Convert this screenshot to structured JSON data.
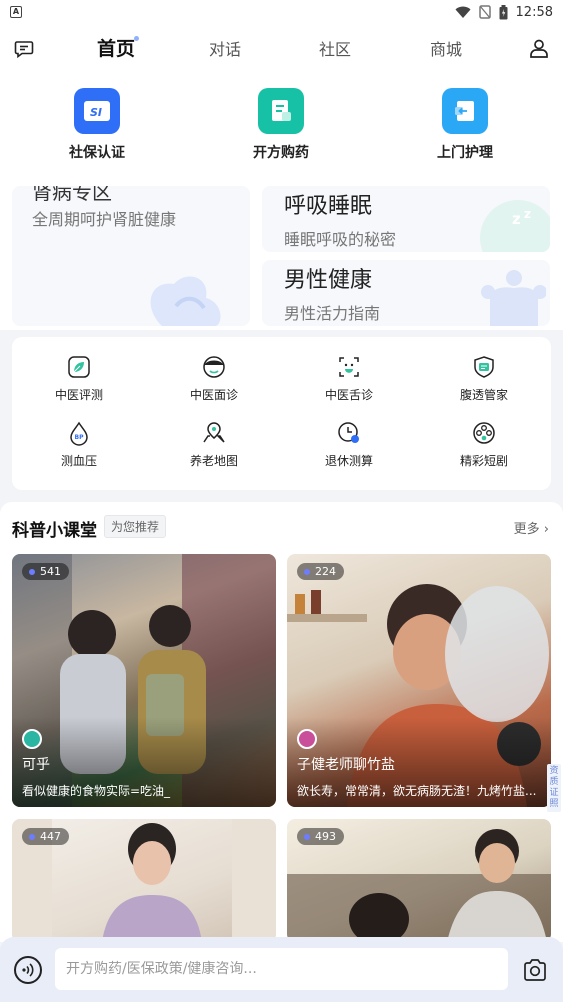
{
  "status_bar": {
    "time": "12:58"
  },
  "header": {
    "tabs": [
      "首页",
      "对话",
      "社区",
      "商城"
    ],
    "active_tab": 0
  },
  "quick_services": [
    {
      "label": "社保认证",
      "icon": "social-security-icon",
      "color": "#2f6ef6"
    },
    {
      "label": "开方购药",
      "icon": "prescription-icon",
      "color": "#16c1a6"
    },
    {
      "label": "上门护理",
      "icon": "home-care-icon",
      "color": "#2aa7f5"
    }
  ],
  "feature_cards": {
    "big": {
      "title": "肾病专区",
      "subtitle": "全周期呵护肾脏健康"
    },
    "small": [
      {
        "title": "呼吸睡眠",
        "subtitle": "睡眠呼吸的秘密"
      },
      {
        "title": "男性健康",
        "subtitle": "男性活力指南"
      }
    ]
  },
  "tcm_grid": [
    {
      "label": "中医评测",
      "icon": "leaf-icon"
    },
    {
      "label": "中医面诊",
      "icon": "face-icon"
    },
    {
      "label": "中医舌诊",
      "icon": "tongue-icon"
    },
    {
      "label": "腹透管家",
      "icon": "dialysis-icon"
    },
    {
      "label": "测血压",
      "icon": "blood-pressure-icon"
    },
    {
      "label": "养老地图",
      "icon": "map-pin-icon"
    },
    {
      "label": "退休测算",
      "icon": "clock-icon"
    },
    {
      "label": "精彩短剧",
      "icon": "film-reel-icon"
    }
  ],
  "science": {
    "title": "科普小课堂",
    "tag": "为您推荐",
    "more": "更多",
    "videos": [
      {
        "views": "541",
        "author": "可乎",
        "caption": "看似健康的食物实际=吃油_"
      },
      {
        "views": "224",
        "author": "子健老师聊竹盐",
        "caption": "欲长寿，常常清，欲无病肠无渣！九烤竹盐..."
      },
      {
        "views": "447",
        "author": "",
        "caption": ""
      },
      {
        "views": "493",
        "author": "",
        "caption": ""
      }
    ]
  },
  "side_tag": "资质证照",
  "bottom_bar": {
    "placeholder": "开方购药/医保政策/健康咨询..."
  }
}
